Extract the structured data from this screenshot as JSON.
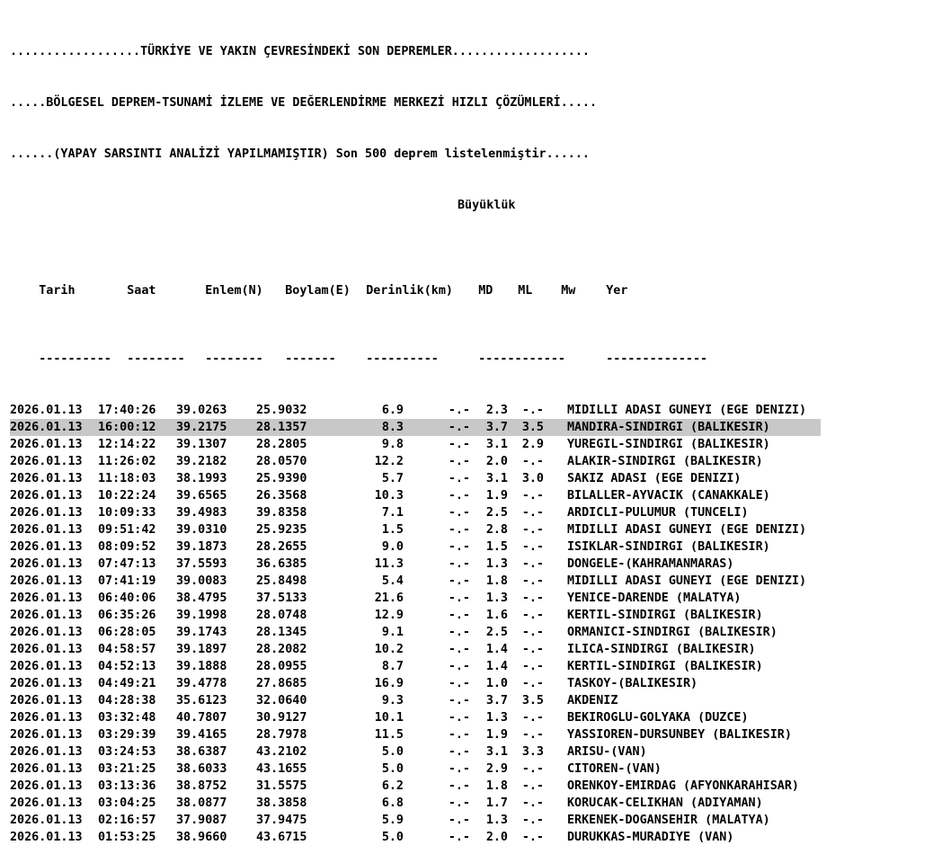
{
  "header": {
    "line1": "..................TÜRKİYE VE YAKIN ÇEVRESİNDEKİ SON DEPREMLER...................",
    "line2": ".....BÖLGESEL DEPREM-TSUNAMİ İZLEME VE DEĞERLENDİRME MERKEZİ HIZLI ÇÖZÜMLERİ.....",
    "line3": "......(YAPAY SARSINTI ANALİZİ YAPILMAMIŞTIR) Son 500 deprem listelenmiştir......",
    "magnitude_group": "Büyüklük"
  },
  "columns": {
    "date": "Tarih",
    "time": "Saat",
    "lat": "Enlem(N)",
    "lon": "Boylam(E)",
    "depth": "Derinlik(km)",
    "md": "MD",
    "ml": "ML",
    "mw": "Mw",
    "location": "Yer"
  },
  "separators": {
    "date": "----------",
    "time": "--------",
    "lat": "--------",
    "lon": "-------",
    "depth": "----------",
    "mag": "------------",
    "location": "--------------"
  },
  "rows": [
    {
      "date": "2026.01.13",
      "time": "17:40:26",
      "lat": "39.0263",
      "lon": "25.9032",
      "depth": "6.9",
      "md": "-.-",
      "ml": "2.3",
      "mw": "-.-",
      "location": "MIDILLI ADASI GUNEYI (EGE DENIZI)"
    },
    {
      "date": "2026.01.13",
      "time": "16:00:12",
      "lat": "39.2175",
      "lon": "28.1357",
      "depth": "8.3",
      "md": "-.-",
      "ml": "3.7",
      "mw": "3.5",
      "location": "MANDIRA-SINDIRGI (BALIKESIR)"
    },
    {
      "date": "2026.01.13",
      "time": "12:14:22",
      "lat": "39.1307",
      "lon": "28.2805",
      "depth": "9.8",
      "md": "-.-",
      "ml": "3.1",
      "mw": "2.9",
      "location": "YUREGIL-SINDIRGI (BALIKESIR)"
    },
    {
      "date": "2026.01.13",
      "time": "11:26:02",
      "lat": "39.2182",
      "lon": "28.0570",
      "depth": "12.2",
      "md": "-.-",
      "ml": "2.0",
      "mw": "-.-",
      "location": "ALAKIR-SINDIRGI (BALIKESIR)"
    },
    {
      "date": "2026.01.13",
      "time": "11:18:03",
      "lat": "38.1993",
      "lon": "25.9390",
      "depth": "5.7",
      "md": "-.-",
      "ml": "3.1",
      "mw": "3.0",
      "location": "SAKIZ ADASI (EGE DENIZI)"
    },
    {
      "date": "2026.01.13",
      "time": "10:22:24",
      "lat": "39.6565",
      "lon": "26.3568",
      "depth": "10.3",
      "md": "-.-",
      "ml": "1.9",
      "mw": "-.-",
      "location": "BILALLER-AYVACIK (CANAKKALE)"
    },
    {
      "date": "2026.01.13",
      "time": "10:09:33",
      "lat": "39.4983",
      "lon": "39.8358",
      "depth": "7.1",
      "md": "-.-",
      "ml": "2.5",
      "mw": "-.-",
      "location": "ARDICLI-PULUMUR (TUNCELI)"
    },
    {
      "date": "2026.01.13",
      "time": "09:51:42",
      "lat": "39.0310",
      "lon": "25.9235",
      "depth": "1.5",
      "md": "-.-",
      "ml": "2.8",
      "mw": "-.-",
      "location": "MIDILLI ADASI GUNEYI (EGE DENIZI)"
    },
    {
      "date": "2026.01.13",
      "time": "08:09:52",
      "lat": "39.1873",
      "lon": "28.2655",
      "depth": "9.0",
      "md": "-.-",
      "ml": "1.5",
      "mw": "-.-",
      "location": "ISIKLAR-SINDIRGI (BALIKESIR)"
    },
    {
      "date": "2026.01.13",
      "time": "07:47:13",
      "lat": "37.5593",
      "lon": "36.6385",
      "depth": "11.3",
      "md": "-.-",
      "ml": "1.3",
      "mw": "-.-",
      "location": "DONGELE-(KAHRAMANMARAS)"
    },
    {
      "date": "2026.01.13",
      "time": "07:41:19",
      "lat": "39.0083",
      "lon": "25.8498",
      "depth": "5.4",
      "md": "-.-",
      "ml": "1.8",
      "mw": "-.-",
      "location": "MIDILLI ADASI GUNEYI (EGE DENIZI)"
    },
    {
      "date": "2026.01.13",
      "time": "06:40:06",
      "lat": "38.4795",
      "lon": "37.5133",
      "depth": "21.6",
      "md": "-.-",
      "ml": "1.3",
      "mw": "-.-",
      "location": "YENICE-DARENDE (MALATYA)"
    },
    {
      "date": "2026.01.13",
      "time": "06:35:26",
      "lat": "39.1998",
      "lon": "28.0748",
      "depth": "12.9",
      "md": "-.-",
      "ml": "1.6",
      "mw": "-.-",
      "location": "KERTIL-SINDIRGI (BALIKESIR)"
    },
    {
      "date": "2026.01.13",
      "time": "06:28:05",
      "lat": "39.1743",
      "lon": "28.1345",
      "depth": "9.1",
      "md": "-.-",
      "ml": "2.5",
      "mw": "-.-",
      "location": "ORMANICI-SINDIRGI (BALIKESIR)"
    },
    {
      "date": "2026.01.13",
      "time": "04:58:57",
      "lat": "39.1897",
      "lon": "28.2082",
      "depth": "10.2",
      "md": "-.-",
      "ml": "1.4",
      "mw": "-.-",
      "location": "ILICA-SINDIRGI (BALIKESIR)"
    },
    {
      "date": "2026.01.13",
      "time": "04:52:13",
      "lat": "39.1888",
      "lon": "28.0955",
      "depth": "8.7",
      "md": "-.-",
      "ml": "1.4",
      "mw": "-.-",
      "location": "KERTIL-SINDIRGI (BALIKESIR)"
    },
    {
      "date": "2026.01.13",
      "time": "04:49:21",
      "lat": "39.4778",
      "lon": "27.8685",
      "depth": "16.9",
      "md": "-.-",
      "ml": "1.0",
      "mw": "-.-",
      "location": "TASKOY-(BALIKESIR)"
    },
    {
      "date": "2026.01.13",
      "time": "04:28:38",
      "lat": "35.6123",
      "lon": "32.0640",
      "depth": "9.3",
      "md": "-.-",
      "ml": "3.7",
      "mw": "3.5",
      "location": "AKDENIZ"
    },
    {
      "date": "2026.01.13",
      "time": "03:32:48",
      "lat": "40.7807",
      "lon": "30.9127",
      "depth": "10.1",
      "md": "-.-",
      "ml": "1.3",
      "mw": "-.-",
      "location": "BEKIROGLU-GOLYAKA (DUZCE)"
    },
    {
      "date": "2026.01.13",
      "time": "03:29:39",
      "lat": "39.4165",
      "lon": "28.7978",
      "depth": "11.5",
      "md": "-.-",
      "ml": "1.9",
      "mw": "-.-",
      "location": "YASSIOREN-DURSUNBEY (BALIKESIR)"
    },
    {
      "date": "2026.01.13",
      "time": "03:24:53",
      "lat": "38.6387",
      "lon": "43.2102",
      "depth": "5.0",
      "md": "-.-",
      "ml": "3.1",
      "mw": "3.3",
      "location": "ARISU-(VAN)"
    },
    {
      "date": "2026.01.13",
      "time": "03:21:25",
      "lat": "38.6033",
      "lon": "43.1655",
      "depth": "5.0",
      "md": "-.-",
      "ml": "2.9",
      "mw": "-.-",
      "location": "CITOREN-(VAN)"
    },
    {
      "date": "2026.01.13",
      "time": "03:13:36",
      "lat": "38.8752",
      "lon": "31.5575",
      "depth": "6.2",
      "md": "-.-",
      "ml": "1.8",
      "mw": "-.-",
      "location": "ORENKOY-EMIRDAG (AFYONKARAHISAR)"
    },
    {
      "date": "2026.01.13",
      "time": "03:04:25",
      "lat": "38.0877",
      "lon": "38.3858",
      "depth": "6.8",
      "md": "-.-",
      "ml": "1.7",
      "mw": "-.-",
      "location": "KORUCAK-CELIKHAN (ADIYAMAN)"
    },
    {
      "date": "2026.01.13",
      "time": "02:16:57",
      "lat": "37.9087",
      "lon": "37.9475",
      "depth": "5.9",
      "md": "-.-",
      "ml": "1.3",
      "mw": "-.-",
      "location": "ERKENEK-DOGANSEHIR (MALATYA)"
    },
    {
      "date": "2026.01.13",
      "time": "01:53:25",
      "lat": "38.9660",
      "lon": "43.6715",
      "depth": "5.0",
      "md": "-.-",
      "ml": "2.0",
      "mw": "-.-",
      "location": "DURUKKAS-MURADIYE (VAN)"
    }
  ],
  "selected_row": 1,
  "colors": {
    "text": "#000000",
    "background": "#ffffff",
    "highlight": "#c8c8c8"
  }
}
